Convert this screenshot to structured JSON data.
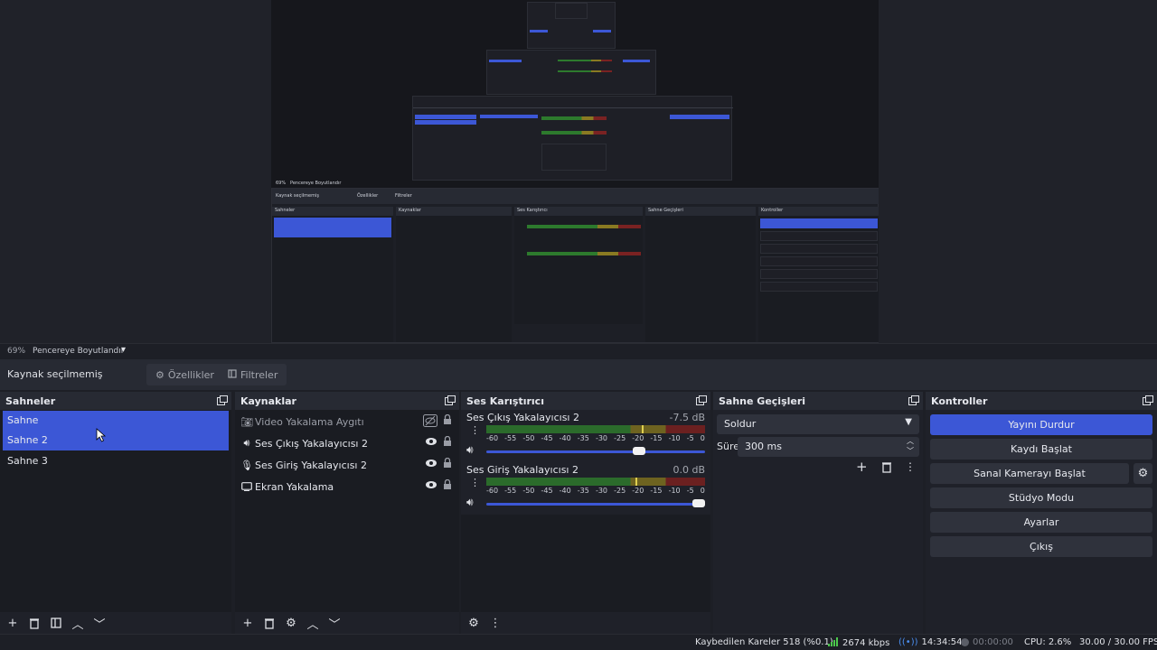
{
  "preview": {
    "mini_labels": {
      "zoom": "69%",
      "fit": "Pencereye Boyutlandır",
      "no_source": "Kaynak seçilmemiş",
      "properties": "Özellikler",
      "filters": "Filtreler",
      "scenes": "Sahneler",
      "sources": "Kaynaklar",
      "mixer": "Ses Karıştırıcı",
      "transitions": "Sahne Geçişleri",
      "controls": "Kontroller"
    }
  },
  "zoombar": {
    "zoom": "69%",
    "scale_mode": "Pencereye Boyutlandır"
  },
  "source_toolbar": {
    "label": "Kaynak seçilmemiş",
    "properties": "Özellikler",
    "filters": "Filtreler"
  },
  "scenes": {
    "title": "Sahneler",
    "items": [
      "Sahne",
      "Sahne 2",
      "Sahne 3"
    ]
  },
  "sources": {
    "title": "Kaynaklar",
    "items": [
      {
        "label": "Video Yakalama Aygıtı",
        "icon": "camera-icon"
      },
      {
        "label": "Ses Çıkış Yakalayıcısı 2",
        "icon": "speaker-icon"
      },
      {
        "label": "Ses Giriş Yakalayıcısı 2",
        "icon": "microphone-icon"
      },
      {
        "label": "Ekran Yakalama",
        "icon": "monitor-icon"
      }
    ]
  },
  "mixer": {
    "title": "Ses Karıştırıcı",
    "ticks": [
      "-60",
      "-55",
      "-50",
      "-45",
      "-40",
      "-35",
      "-30",
      "-25",
      "-20",
      "-15",
      "-10",
      "-5",
      "0"
    ],
    "channels": [
      {
        "name": "Ses Çıkış Yakalayıcısı 2",
        "db": "-7.5 dB",
        "level": 0.71,
        "fader": 0.7
      },
      {
        "name": "Ses Giriş Yakalayıcısı 2",
        "db": "0.0 dB",
        "level": 0.68,
        "fader": 1.0
      }
    ]
  },
  "transitions": {
    "title": "Sahne Geçişleri",
    "selected": "Soldur",
    "duration_label": "Süre",
    "duration": "300 ms"
  },
  "controls": {
    "title": "Kontroller",
    "buttons": [
      "Yayını Durdur",
      "Kaydı Başlat",
      "Sanal Kamerayı Başlat",
      "Stüdyo Modu",
      "Ayarlar",
      "Çıkış"
    ]
  },
  "status": {
    "dropped": "Kaybedilen Kareler 518 (%0.1)",
    "bitrate": "2674 kbps",
    "stream_time": "14:34:54",
    "record_time": "00:00:00",
    "cpu": "CPU: 2.6%",
    "fps": "30.00 / 30.00 FPS"
  },
  "colors": {
    "accent": "#3c57d6",
    "background": "#1d1f26",
    "panel": "#1f2129",
    "meter_green": "#2b6b2b",
    "meter_yellow": "#6e6320",
    "meter_red": "#6b2020"
  }
}
